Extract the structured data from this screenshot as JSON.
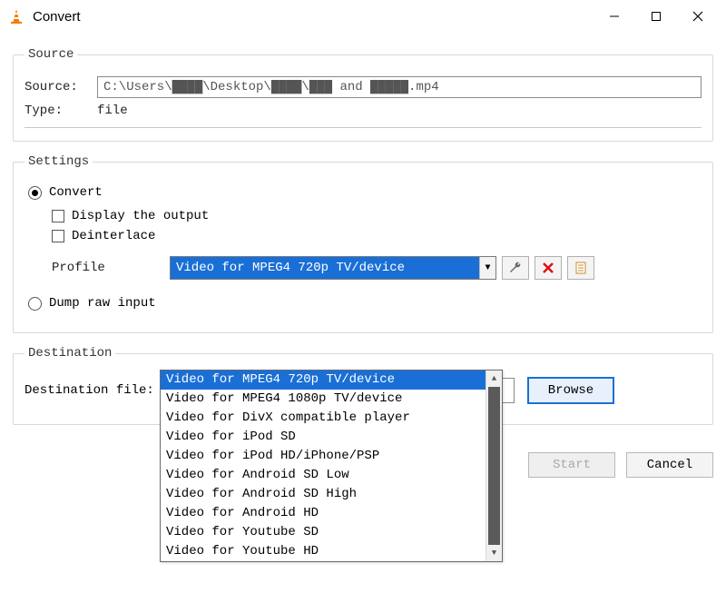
{
  "window": {
    "title": "Convert"
  },
  "source": {
    "legend": "Source",
    "source_label": "Source:",
    "source_value": "C:\\Users\\████\\Desktop\\████\\███ and █████.mp4",
    "type_label": "Type:",
    "type_value": "file"
  },
  "settings": {
    "legend": "Settings",
    "convert_label": "Convert",
    "display_output_label": "Display the output",
    "deinterlace_label": "Deinterlace",
    "profile_label": "Profile",
    "profile_selected": "Video for MPEG4 720p TV/device",
    "profile_options": [
      "Video for MPEG4 720p TV/device",
      "Video for MPEG4 1080p TV/device",
      "Video for DivX compatible player",
      "Video for iPod SD",
      "Video for iPod HD/iPhone/PSP",
      "Video for Android SD Low",
      "Video for Android SD High",
      "Video for Android HD",
      "Video for Youtube SD",
      "Video for Youtube HD"
    ],
    "dump_label": "Dump raw input"
  },
  "destination": {
    "legend": "Destination",
    "file_label": "Destination file:",
    "file_value": "",
    "browse_label": "Browse"
  },
  "buttons": {
    "start": "Start",
    "cancel": "Cancel"
  }
}
